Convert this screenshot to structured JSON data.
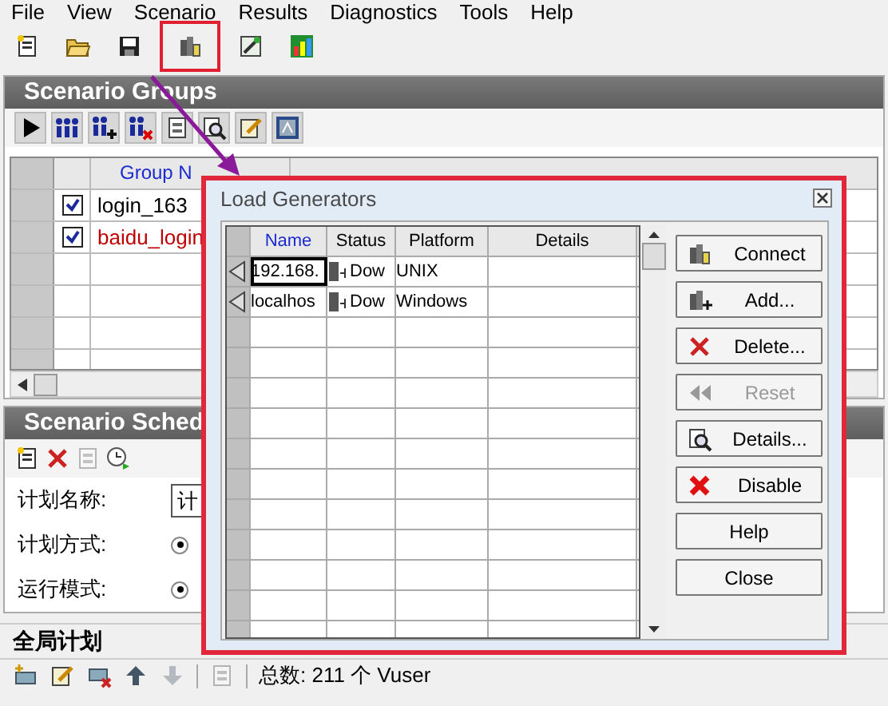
{
  "menu": [
    "File",
    "View",
    "Scenario",
    "Results",
    "Diagnostics",
    "Tools",
    "Help"
  ],
  "toolbar": [
    {
      "kind": "new",
      "selected": false
    },
    {
      "kind": "open",
      "selected": false
    },
    {
      "kind": "save",
      "selected": false
    },
    {
      "kind": "generators",
      "selected": true
    },
    {
      "kind": "wand",
      "selected": false
    },
    {
      "kind": "analysis",
      "selected": false
    }
  ],
  "scenario_groups": {
    "title": "Scenario Groups",
    "toolbar": [
      {
        "kind": "play"
      },
      {
        "kind": "users"
      },
      {
        "kind": "add-user"
      },
      {
        "kind": "remove-user"
      },
      {
        "kind": "sheet"
      },
      {
        "kind": "details"
      },
      {
        "kind": "edit"
      },
      {
        "kind": "script"
      }
    ],
    "columns": [
      "Group N"
    ],
    "rows": [
      {
        "name": "login_163",
        "checked": true,
        "color": "#000000"
      },
      {
        "name": "baidu_login",
        "checked": true,
        "color": "#c00000"
      }
    ]
  },
  "scenario_schedule": {
    "title": "Scenario Sched",
    "toolbar": [
      {
        "kind": "new",
        "disabled": false
      },
      {
        "kind": "delete",
        "disabled": false
      },
      {
        "kind": "sheet",
        "disabled": true
      },
      {
        "kind": "clock",
        "disabled": false
      }
    ],
    "fields": [
      {
        "label": "计划名称:",
        "kind": "text",
        "value": "计"
      },
      {
        "label": "计划方式:",
        "kind": "radio",
        "selected": true
      },
      {
        "label": "运行模式:",
        "kind": "radio",
        "selected": true
      }
    ]
  },
  "global_schedule": {
    "title": "全局计划",
    "toolbar": [
      {
        "kind": "add-group",
        "disabled": false
      },
      {
        "kind": "edit",
        "disabled": false
      },
      {
        "kind": "remove-group",
        "disabled": false
      },
      {
        "kind": "up",
        "disabled": false
      },
      {
        "kind": "down",
        "disabled": true
      },
      {
        "kind": "sheet",
        "disabled": true
      }
    ],
    "total": "总数: 211 个 Vuser"
  },
  "dialog": {
    "title": "Load Generators",
    "columns": [
      {
        "label": "Name",
        "sorted": true
      },
      {
        "label": "Status",
        "sorted": false
      },
      {
        "label": "Platform",
        "sorted": false
      },
      {
        "label": "Details",
        "sorted": false
      }
    ],
    "rows": [
      {
        "name": "192.168.",
        "status": "Dow",
        "platform": "UNIX",
        "focused": true
      },
      {
        "name": "localhos",
        "status": "Dow",
        "platform": "Windows",
        "focused": false
      }
    ],
    "buttons": [
      {
        "label": "Connect",
        "kind": "connect",
        "disabled": false
      },
      {
        "label": "Add...",
        "kind": "add",
        "disabled": false
      },
      {
        "label": "Delete...",
        "kind": "delete",
        "disabled": false
      },
      {
        "label": "Reset",
        "kind": "reset",
        "disabled": true
      },
      {
        "label": "Details...",
        "kind": "details",
        "disabled": false
      },
      {
        "label": "Disable",
        "kind": "disable",
        "disabled": false
      },
      {
        "label": "Help",
        "kind": "none",
        "disabled": false
      },
      {
        "label": "Close",
        "kind": "none",
        "disabled": false
      }
    ]
  }
}
